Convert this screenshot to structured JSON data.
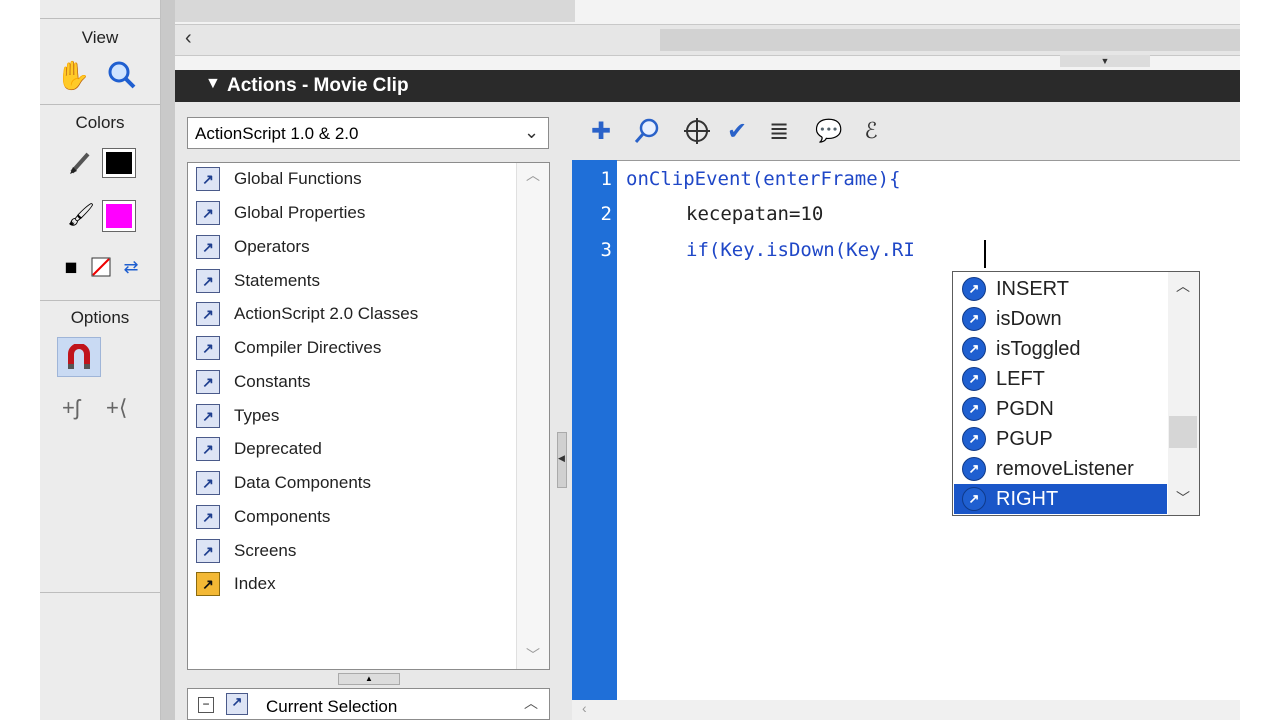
{
  "tools_panel": {
    "view_label": "View",
    "colors_label": "Colors",
    "options_label": "Options",
    "stroke_color": "#000000",
    "fill_color": "#ff00ff"
  },
  "panel": {
    "title": "Actions - Movie Clip",
    "collapse_glyph": "▼"
  },
  "version_select": {
    "value": "ActionScript 1.0 & 2.0"
  },
  "toolbox": {
    "items": [
      {
        "label": "Global Functions"
      },
      {
        "label": "Global Properties"
      },
      {
        "label": "Operators"
      },
      {
        "label": "Statements"
      },
      {
        "label": "ActionScript 2.0 Classes"
      },
      {
        "label": "Compiler Directives"
      },
      {
        "label": "Constants"
      },
      {
        "label": "Types"
      },
      {
        "label": "Deprecated"
      },
      {
        "label": "Data Components"
      },
      {
        "label": "Components"
      },
      {
        "label": "Screens"
      },
      {
        "label": "Index"
      }
    ]
  },
  "current_selection": {
    "label": "Current Selection"
  },
  "editor": {
    "lines": [
      {
        "num": "1",
        "text": "onClipEvent(enterFrame){"
      },
      {
        "num": "2",
        "text": "kecepatan=10"
      },
      {
        "num": "3",
        "text": "if(Key.isDown(Key.RI"
      }
    ]
  },
  "code_hint": {
    "items": [
      {
        "label": "INSERT"
      },
      {
        "label": "isDown"
      },
      {
        "label": "isToggled"
      },
      {
        "label": "LEFT"
      },
      {
        "label": "PGDN"
      },
      {
        "label": "PGUP"
      },
      {
        "label": "removeListener"
      },
      {
        "label": "RIGHT"
      }
    ],
    "selected": "RIGHT"
  },
  "colors": {
    "gutter": "#1f6fd8",
    "keyword": "#1f47c7",
    "selection": "#1a56c8"
  }
}
